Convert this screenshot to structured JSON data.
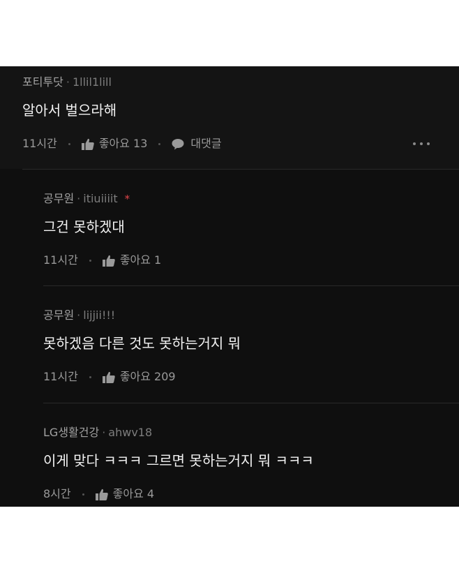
{
  "comments": [
    {
      "author": "포티투닷",
      "handle": "1llil1lill",
      "text": "알아서 벌으라해",
      "time": "11시간",
      "like_label": "좋아요 13",
      "reply_label": "대댓글"
    },
    {
      "author": "공무원",
      "handle": "itiuiiiit",
      "badge": "*",
      "text": "그건 못하겠대",
      "time": "11시간",
      "like_label": "좋아요 1"
    },
    {
      "author": "공무원",
      "handle": "lijjii!!!",
      "text": "못하겠음 다른 것도 못하는거지 뭐",
      "time": "11시간",
      "like_label": "좋아요 209"
    },
    {
      "author": "LG생활건강",
      "handle": "ahwv18",
      "text": "이게 맞다 ㅋㅋㅋ 그르면 못하는거지 뭐 ㅋㅋㅋ",
      "time": "8시간",
      "like_label": "좋아요 4"
    }
  ],
  "separator": "·",
  "colors": {
    "background": "#0f0f0f",
    "top_comment_background": "#141414",
    "text": "#f2f2f2",
    "meta": "#8e8e8e",
    "badge": "#e0454a"
  }
}
